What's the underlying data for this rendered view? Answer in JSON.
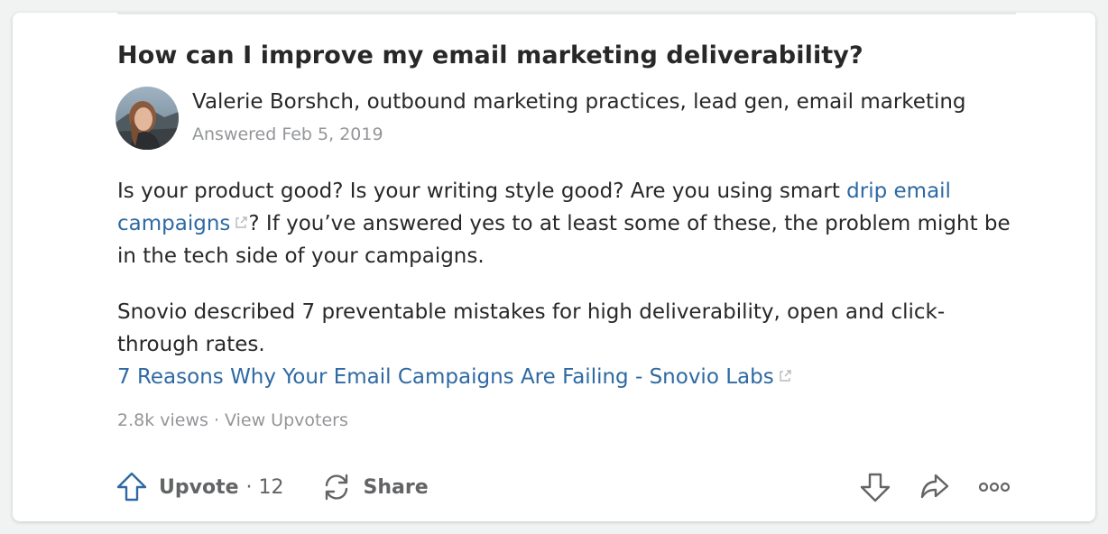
{
  "question": {
    "title": "How can I improve my email marketing deliverability?"
  },
  "author": {
    "name_line": "Valerie Borshch, outbound marketing practices, lead gen, email marketing",
    "answered": "Answered Feb 5, 2019"
  },
  "answer": {
    "p1_text1": "Is your product good? Is your writing style good? Are you using smart ",
    "p1_link": "drip email campaigns",
    "p1_text2": "? If you’ve answered yes to at least some of these, the problem might be in the tech side of your campaigns.",
    "p2_text": "Snovio described 7 preventable mistakes for high deliverability, open and click-through rates.",
    "p2_link": "7 Reasons Why Your Email Campaigns Are Failing - Snovio Labs"
  },
  "stats": {
    "views": "2.8k views",
    "separator": " · ",
    "view_upvoters": "View Upvoters"
  },
  "actions": {
    "upvote_label": "Upvote",
    "upvote_count": "· 12",
    "share_label": "Share"
  },
  "icons": {
    "upvote": "upvote-arrow-icon",
    "share": "share-cycle-icon",
    "downvote": "downvote-arrow-icon",
    "forward": "forward-arrow-icon",
    "more": "more-dots-icon",
    "external": "external-link-icon"
  },
  "colors": {
    "link": "#2e69a3",
    "upvote_accent": "#2e69a3",
    "text": "#282829",
    "muted": "#939598"
  }
}
